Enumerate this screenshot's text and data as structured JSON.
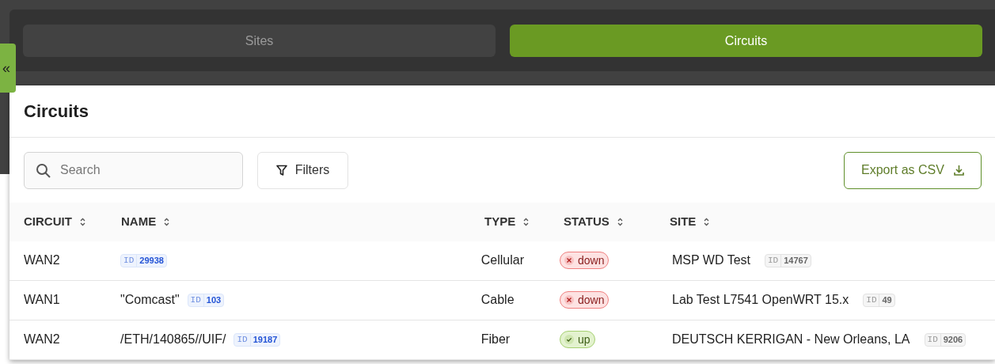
{
  "tabs": [
    {
      "label": "Sites",
      "selected": false
    },
    {
      "label": "Circuits",
      "selected": true
    }
  ],
  "collapse_button": {
    "label": "«"
  },
  "panel": {
    "title": "Circuits",
    "search": {
      "placeholder": "Search"
    },
    "filters_button": "Filters",
    "export_button": "Export as CSV"
  },
  "table": {
    "columns": [
      "CIRCUIT",
      "NAME",
      "TYPE",
      "STATUS",
      "SITE"
    ],
    "rows": [
      {
        "circuit": "WAN2",
        "name": {
          "id_badge": {
            "label": "ID",
            "value": "29938"
          }
        },
        "type": "Cellular",
        "status": {
          "text": "down",
          "failed": true
        },
        "site": {
          "text": "MSP WD Test",
          "id_badge": {
            "label": "ID",
            "value": "14767"
          }
        }
      },
      {
        "circuit": "WAN1",
        "name": {
          "text": "\"Comcast\"",
          "id_badge": {
            "label": "ID",
            "value": "103"
          }
        },
        "type": "Cable",
        "status": {
          "text": "down",
          "failed": true
        },
        "site": {
          "text": "Lab Test L7541 OpenWRT 15.x",
          "id_badge": {
            "label": "ID",
            "value": "49"
          }
        }
      },
      {
        "circuit": "WAN2",
        "name": {
          "text": "/ETH/140865//UIF/",
          "id_badge": {
            "label": "ID",
            "value": "19187"
          }
        },
        "type": "Fiber",
        "status": {
          "text": "up",
          "failed": false
        },
        "site": {
          "text": "DEUTSCH KERRIGAN - New Orleans, LA",
          "id_badge": {
            "label": "ID",
            "value": "9206"
          }
        }
      }
    ]
  }
}
